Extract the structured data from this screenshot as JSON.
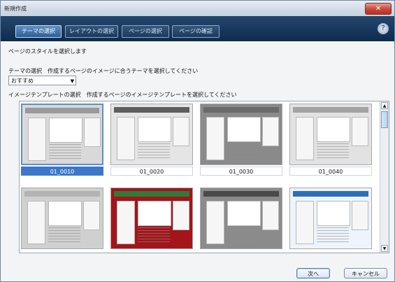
{
  "window": {
    "title": "新規作成",
    "close_label": "✕",
    "help_icon": "help-icon"
  },
  "steps": [
    {
      "label": "テーマの選択",
      "active": true
    },
    {
      "label": "レイアウトの選択",
      "active": false
    },
    {
      "label": "ページの選択",
      "active": false
    },
    {
      "label": "ページの確認",
      "active": false
    }
  ],
  "page": {
    "heading": "ページのスタイルを選択します"
  },
  "theme": {
    "label": "テーマの選択　作成するページのイメージに合うテーマを選択してください",
    "selected": "おすすめ"
  },
  "template": {
    "label": "イメージテンプレートの選択　作成するページのイメージテンプレートを選択してください"
  },
  "templates": [
    {
      "name": "01_0010",
      "selected": true,
      "header_color": "#9a9a9a",
      "body_color": "#d9d9d9"
    },
    {
      "name": "01_0020",
      "selected": false,
      "header_color": "#5e5e5e",
      "body_color": "#e5e5e5"
    },
    {
      "name": "01_0030",
      "selected": false,
      "header_color": "#6a6a6a",
      "body_color": "#8a8a8a"
    },
    {
      "name": "01_0040",
      "selected": false,
      "header_color": "#a3a3a3",
      "body_color": "#e2e2e2"
    },
    {
      "name": "",
      "selected": false,
      "header_color": "#b3b3b3",
      "body_color": "#d0d0d0"
    },
    {
      "name": "",
      "selected": false,
      "header_color": "#2f7a3a",
      "body_color": "#a3151a"
    },
    {
      "name": "",
      "selected": false,
      "header_color": "#4a4a4a",
      "body_color": "#8b8b8b"
    },
    {
      "name": "",
      "selected": false,
      "header_color": "#2c6fb8",
      "body_color": "#eef4fb"
    }
  ],
  "buttons": {
    "next": "次へ",
    "cancel": "キャンセル"
  },
  "colors": {
    "accent": "#3b78c8",
    "step_bar": "#12325a"
  }
}
